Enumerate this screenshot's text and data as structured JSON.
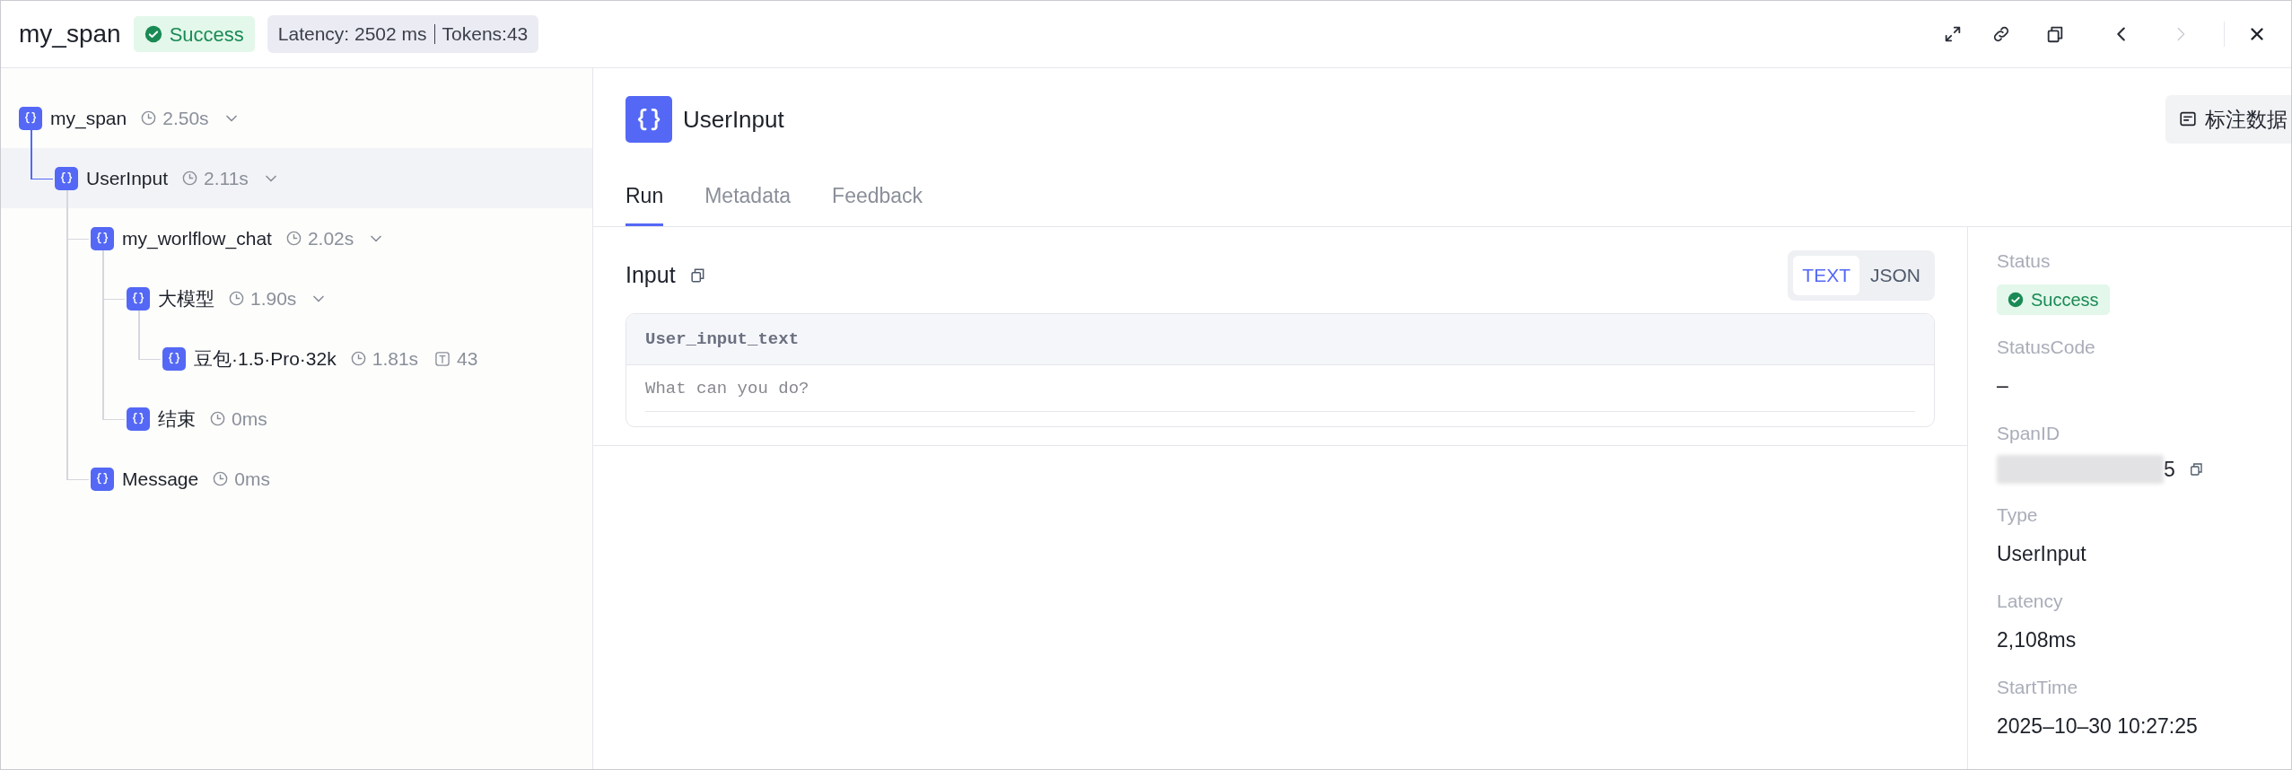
{
  "header": {
    "title": "my_span",
    "status": {
      "label": "Success",
      "kind": "success"
    },
    "latency": "Latency: 2502 ms",
    "tokens": "Tokens:43"
  },
  "nav": [
    {
      "kind": "prev",
      "disabled": false
    },
    {
      "kind": "next",
      "disabled": true
    }
  ],
  "tree": [
    {
      "name": "my_span",
      "duration": "2.50s",
      "expanded": true,
      "selected": false,
      "children": [
        {
          "name": "UserInput",
          "duration": "2.11s",
          "expanded": true,
          "selected": true,
          "children": [
            {
              "name": "my_worlflow_chat",
              "duration": "2.02s",
              "expanded": true,
              "selected": false,
              "children": [
                {
                  "name": "大模型",
                  "duration": "1.90s",
                  "expanded": true,
                  "selected": false,
                  "children": [
                    {
                      "name": "豆包·1.5·Pro·32k",
                      "duration": "1.81s",
                      "tokens": "43",
                      "selected": false
                    }
                  ]
                },
                {
                  "name": "结束",
                  "duration": "0ms",
                  "selected": false
                }
              ]
            },
            {
              "name": "Message",
              "duration": "0ms",
              "selected": false
            }
          ]
        }
      ]
    }
  ],
  "detail": {
    "title": "UserInput",
    "annotate_button": "标注数据",
    "tabs": [
      {
        "label": "Run",
        "selected": true
      },
      {
        "label": "Metadata",
        "selected": false
      },
      {
        "label": "Feedback",
        "selected": false
      }
    ],
    "input": {
      "title": "Input",
      "formats": [
        {
          "label": "TEXT",
          "selected": true
        },
        {
          "label": "JSON",
          "selected": false
        }
      ],
      "field": "User_input_text",
      "value": "What can you do?"
    }
  },
  "info": [
    {
      "label": "Status",
      "kind": "status",
      "value": "Success"
    },
    {
      "label": "StatusCode",
      "kind": "text",
      "value": "–"
    },
    {
      "label": "SpanID",
      "kind": "redacted",
      "value": "5"
    },
    {
      "label": "Type",
      "kind": "text",
      "value": "UserInput"
    },
    {
      "label": "Latency",
      "kind": "text",
      "value": "2,108ms"
    },
    {
      "label": "StartTime",
      "kind": "text",
      "value": "2025–10–30 10:27:25"
    }
  ]
}
